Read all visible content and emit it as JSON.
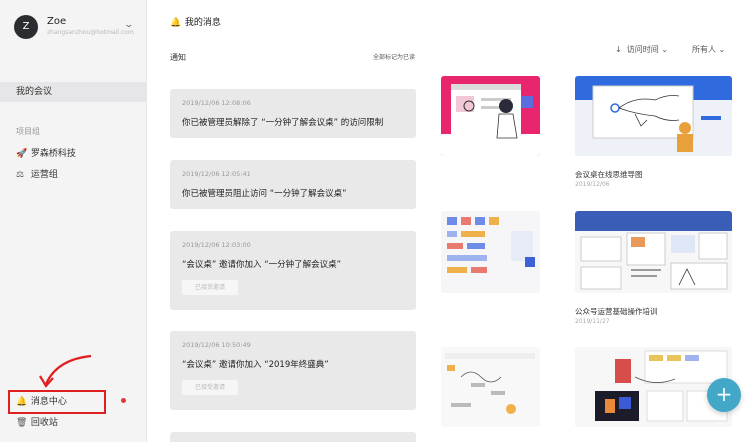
{
  "sidebar": {
    "user": {
      "initial": "Z",
      "name": "Zoe",
      "email": "zhangsanzhou@hotmail.com"
    },
    "my_meetings": "我的会议",
    "group_label": "项目组",
    "groups": [
      {
        "label": "罗森桥科技",
        "icon": "rocket-icon"
      },
      {
        "label": "运营组",
        "icon": "scale-icon"
      }
    ],
    "message_center": "消息中心",
    "trash": "回收站"
  },
  "main": {
    "title": "我的消息",
    "notice_label": "通知",
    "mark_all_read": "全部标记为已读",
    "notifications": [
      {
        "time": "2019/12/06 12:08:06",
        "text": "你已被管理员解除了 “一分钟了解会议桌” 的访问限制",
        "button": ""
      },
      {
        "time": "2019/12/06 12:05:41",
        "text": "你已被管理员阻止访问 “一分钟了解会议桌”",
        "button": ""
      },
      {
        "time": "2019/12/06 12:03:00",
        "text": "“会议桌” 邀请你加入 “一分钟了解会议桌”",
        "button": "已接受邀请"
      },
      {
        "time": "2019/12/06 10:50:49",
        "text": "“会议桌” 邀请你加入 “2019年终盛典”",
        "button": "已接受邀请"
      }
    ]
  },
  "content": {
    "sort_label": "访问时间",
    "owner_label": "所有人",
    "documents": [
      {
        "title": "",
        "date": ""
      },
      {
        "title": "会议桌在线思维导图",
        "date": "2019/12/06"
      },
      {
        "title": "",
        "date": ""
      },
      {
        "title": "公众号运营基础操作培训",
        "date": "2019/11/27"
      },
      {
        "title": "",
        "date": ""
      },
      {
        "title": "",
        "date": ""
      }
    ],
    "fab_label": "+"
  },
  "colors": {
    "accent": "#43a8c8",
    "highlight": "#e02020",
    "dot": "#e03838"
  }
}
